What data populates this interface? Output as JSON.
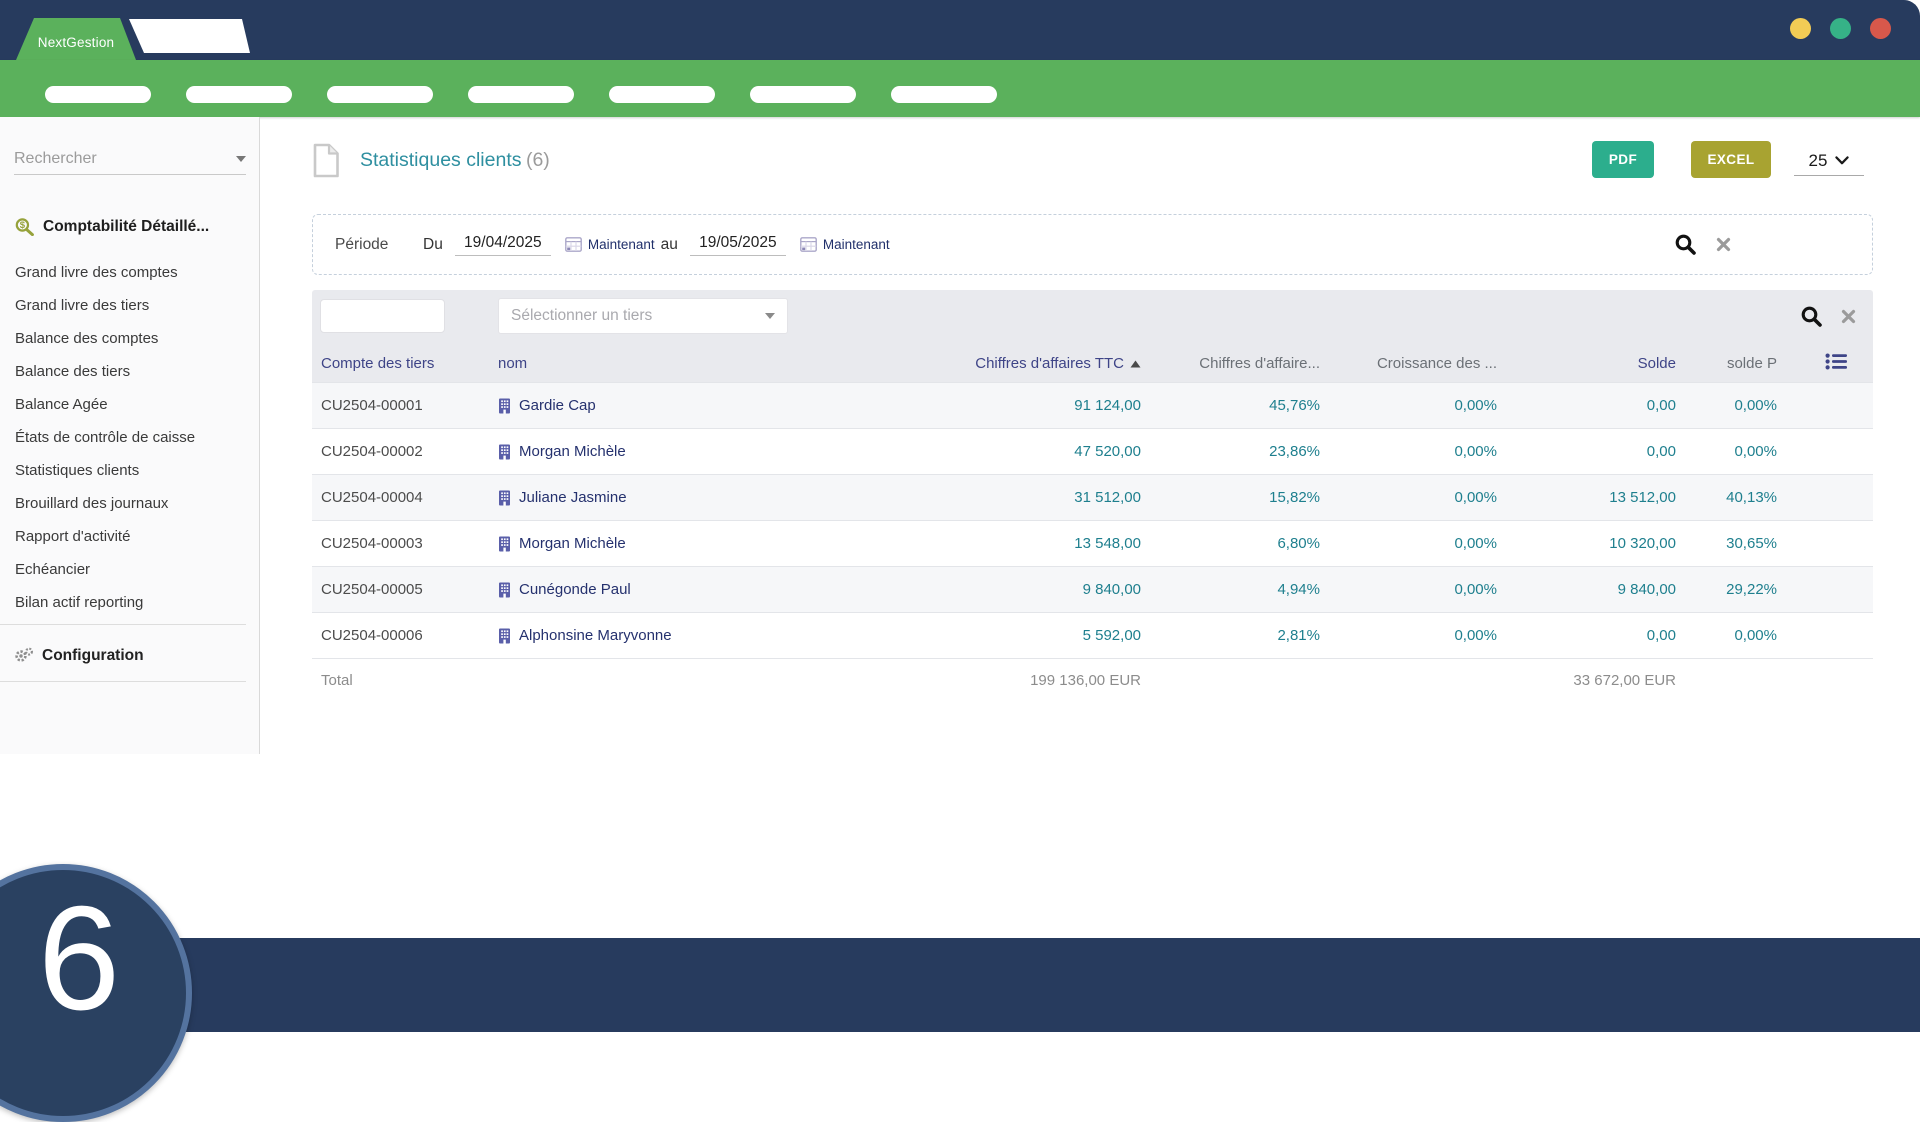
{
  "header": {
    "brand": "NextGestion",
    "nav_pills_count": 7,
    "window_dots": [
      "#F2CC55",
      "#36B287",
      "#D8584B"
    ]
  },
  "sidebar": {
    "search_placeholder": "Rechercher",
    "section_label": "Comptabilité Détaillé...",
    "items": [
      "Grand livre des comptes",
      "Grand livre des tiers",
      "Balance des comptes",
      "Balance des tiers",
      "Balance Agée",
      "États de contrôle de caisse",
      "Statistiques clients",
      "Brouillard des journaux",
      "Rapport d'activité",
      "Echéancier",
      "Bilan actif reporting"
    ],
    "configuration_label": "Configuration"
  },
  "main": {
    "title": "Statistiques clients",
    "count": "(6)",
    "toolbar": {
      "pdf_label": "PDF",
      "excel_label": "EXCEL",
      "page_size": "25"
    },
    "period": {
      "label": "Période",
      "from_prefix": "Du",
      "from_value": "19/04/2025",
      "from_now_label": "Maintenant",
      "to_prefix": "au",
      "to_value": "19/05/2025",
      "to_now_label": "Maintenant"
    },
    "filter": {
      "tiers_placeholder": "Sélectionner un tiers"
    },
    "table": {
      "headers": [
        "Compte des tiers",
        "nom",
        "Chiffres d'affaires TTC",
        "Chiffres d'affaire...",
        "Croissance des ...",
        "Solde",
        "solde P"
      ],
      "sorted_column_index": 2,
      "rows": [
        {
          "account": "CU2504-00001",
          "name": "Gardie Cap",
          "ca_ttc": "91 124,00",
          "ca_pct": "45,76%",
          "croissance": "0,00%",
          "solde": "0,00",
          "solde_pct": "0,00%"
        },
        {
          "account": "CU2504-00002",
          "name": "Morgan Michèle",
          "ca_ttc": "47 520,00",
          "ca_pct": "23,86%",
          "croissance": "0,00%",
          "solde": "0,00",
          "solde_pct": "0,00%"
        },
        {
          "account": "CU2504-00004",
          "name": "Juliane Jasmine",
          "ca_ttc": "31 512,00",
          "ca_pct": "15,82%",
          "croissance": "0,00%",
          "solde": "13 512,00",
          "solde_pct": "40,13%"
        },
        {
          "account": "CU2504-00003",
          "name": "Morgan Michèle",
          "ca_ttc": "13 548,00",
          "ca_pct": "6,80%",
          "croissance": "0,00%",
          "solde": "10 320,00",
          "solde_pct": "30,65%"
        },
        {
          "account": "CU2504-00005",
          "name": "Cunégonde Paul",
          "ca_ttc": "9 840,00",
          "ca_pct": "4,94%",
          "croissance": "0,00%",
          "solde": "9 840,00",
          "solde_pct": "29,22%"
        },
        {
          "account": "CU2504-00006",
          "name": "Alphonsine Maryvonne",
          "ca_ttc": "5 592,00",
          "ca_pct": "2,81%",
          "croissance": "0,00%",
          "solde": "0,00",
          "solde_pct": "0,00%"
        }
      ],
      "total": {
        "label": "Total",
        "ca_ttc_total": "199 136,00 EUR",
        "solde_total": "33 672,00 EUR"
      }
    }
  },
  "footer": {
    "badge_number": "6"
  },
  "colors": {
    "navy": "#273B5E",
    "green": "#5BB15C",
    "teal_title": "#2E8FA0",
    "teal_number": "#1E7F8E",
    "pdf_button": "#2CAE8D",
    "excel_button": "#A8A331",
    "header_navy": "#3E4487",
    "link_navy": "#25316E"
  }
}
